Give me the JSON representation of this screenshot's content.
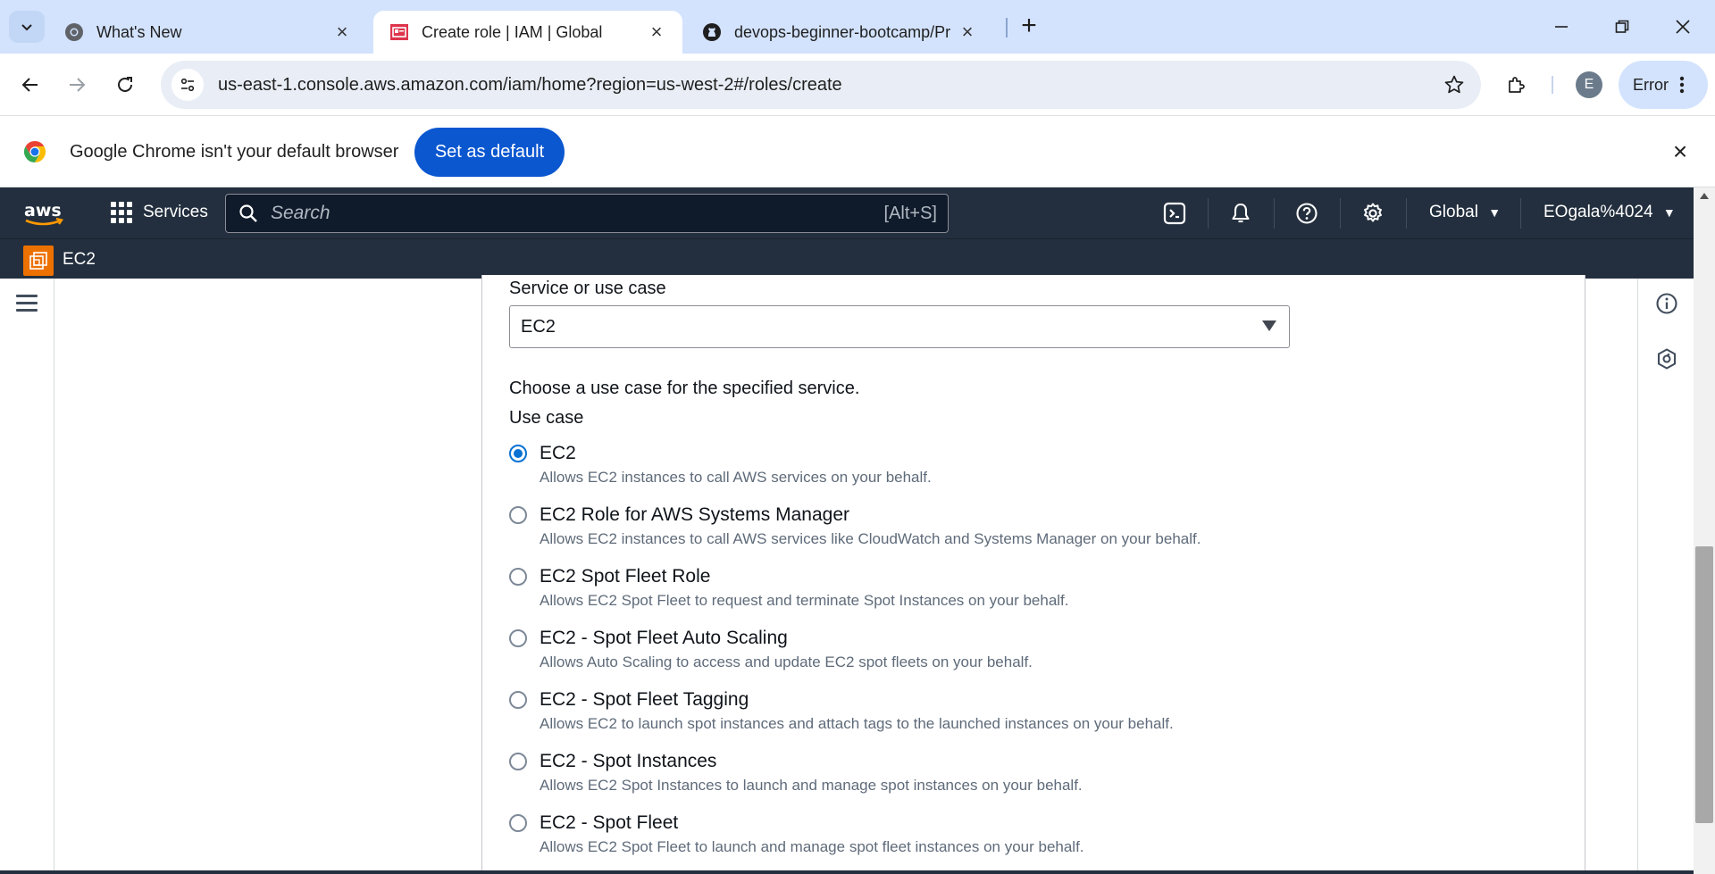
{
  "browser": {
    "tabs": [
      {
        "title": "What's New",
        "icon": "chrome-icon",
        "active": false
      },
      {
        "title": "Create role | IAM | Global",
        "icon": "iam-icon",
        "active": true
      },
      {
        "title": "devops-beginner-bootcamp/Pr",
        "icon": "github-icon",
        "active": false
      }
    ],
    "url": "us-east-1.console.aws.amazon.com/iam/home?region=us-west-2#/roles/create",
    "profile_initial": "E",
    "profile_status": "Error"
  },
  "infobar": {
    "message": "Google Chrome isn't your default browser",
    "button": "Set as default"
  },
  "aws": {
    "services_label": "Services",
    "search_placeholder": "Search",
    "search_shortcut": "[Alt+S]",
    "region": "Global",
    "account": "EOgala%4024",
    "service_name": "EC2"
  },
  "form": {
    "service_label": "Service or use case",
    "service_value": "EC2",
    "choose_text": "Choose a use case for the specified service.",
    "use_case_label": "Use case",
    "options": [
      {
        "title": "EC2",
        "desc": "Allows EC2 instances to call AWS services on your behalf.",
        "checked": true
      },
      {
        "title": "EC2 Role for AWS Systems Manager",
        "desc": "Allows EC2 instances to call AWS services like CloudWatch and Systems Manager on your behalf.",
        "checked": false
      },
      {
        "title": "EC2 Spot Fleet Role",
        "desc": "Allows EC2 Spot Fleet to request and terminate Spot Instances on your behalf.",
        "checked": false
      },
      {
        "title": "EC2 - Spot Fleet Auto Scaling",
        "desc": "Allows Auto Scaling to access and update EC2 spot fleets on your behalf.",
        "checked": false
      },
      {
        "title": "EC2 - Spot Fleet Tagging",
        "desc": "Allows EC2 to launch spot instances and attach tags to the launched instances on your behalf.",
        "checked": false
      },
      {
        "title": "EC2 - Spot Instances",
        "desc": "Allows EC2 Spot Instances to launch and manage spot instances on your behalf.",
        "checked": false
      },
      {
        "title": "EC2 - Spot Fleet",
        "desc": "Allows EC2 Spot Fleet to launch and manage spot fleet instances on your behalf.",
        "checked": false
      }
    ]
  },
  "colors": {
    "aws_nav": "#232f3e",
    "radio_selected": "#0972d3",
    "chrome_button": "#0b57d0",
    "ec2_orange": "#ed7100"
  }
}
